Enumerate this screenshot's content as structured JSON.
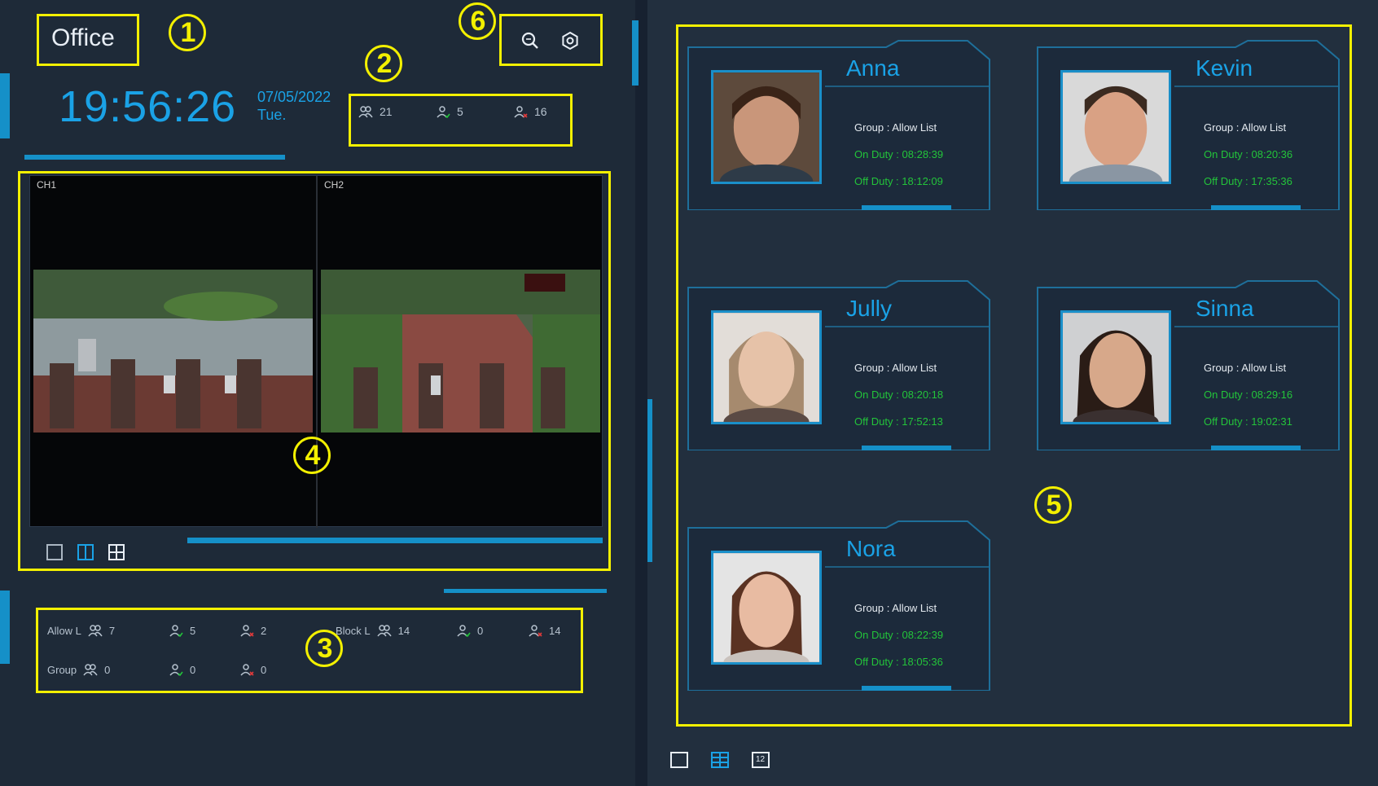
{
  "header": {
    "title": "Office",
    "time": "19:56:26",
    "date": "07/05/2022",
    "weekday": "Tue."
  },
  "summary_stats": {
    "total": "21",
    "present": "5",
    "absent": "16"
  },
  "toolbar": {
    "icons": [
      "search-icon",
      "settings-icon"
    ]
  },
  "video": {
    "channels": [
      {
        "label": "CH1"
      },
      {
        "label": "CH2"
      }
    ],
    "layout_icons": [
      "single-view-icon",
      "dual-view-icon",
      "quad-view-icon"
    ]
  },
  "group_stats": {
    "allow_list": {
      "label": "Allow L",
      "total": "7",
      "present": "5",
      "absent": "2"
    },
    "block_list": {
      "label": "Block L",
      "total": "14",
      "present": "0",
      "absent": "14"
    },
    "group": {
      "label": "Group",
      "total": "0",
      "present": "0",
      "absent": "0"
    }
  },
  "people": [
    {
      "name": "Anna",
      "group": "Group  : Allow List",
      "on_duty": "On Duty  :  08:28:39",
      "off_duty": "Off Duty  :  18:12:09"
    },
    {
      "name": "Kevin",
      "group": "Group  : Allow List",
      "on_duty": "On Duty  :  08:20:36",
      "off_duty": "Off Duty  :  17:35:36"
    },
    {
      "name": "Jully",
      "group": "Group  : Allow List",
      "on_duty": "On Duty  :  08:20:18",
      "off_duty": "Off Duty  :  17:52:13"
    },
    {
      "name": "Sinna",
      "group": "Group  : Allow List",
      "on_duty": "On Duty  :  08:29:16",
      "off_duty": "Off Duty  :  19:02:31"
    },
    {
      "name": "Nora",
      "group": "Group  : Allow List",
      "on_duty": "On Duty  :  08:22:39",
      "off_duty": "Off Duty  :  18:05:36"
    }
  ],
  "right_layout": {
    "icons": [
      "single-view-icon",
      "grid-view-icon",
      "twelve-view-icon"
    ],
    "twelve_label": "12"
  },
  "annotations": [
    "1",
    "2",
    "3",
    "4",
    "5",
    "6"
  ],
  "colors": {
    "accent": "#1aa2e6",
    "on_duty": "#23c43a",
    "highlight": "#f3f000",
    "background": "#1e2a38"
  }
}
